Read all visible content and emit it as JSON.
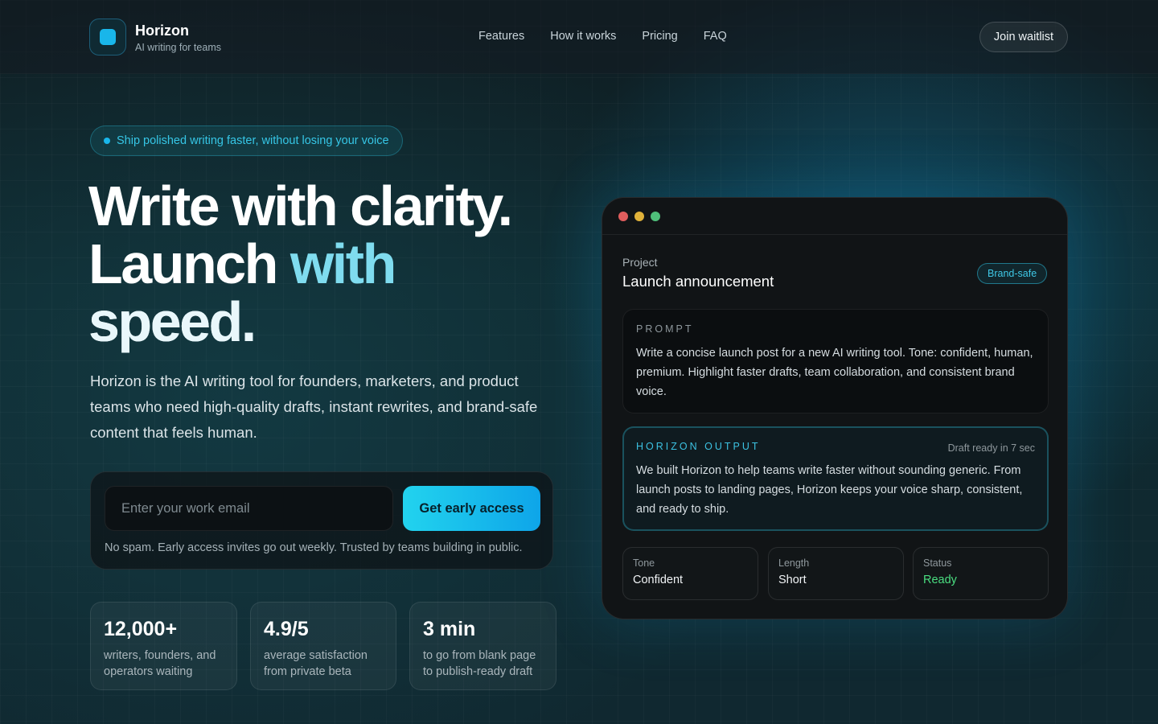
{
  "header": {
    "brand_name": "Horizon",
    "brand_tagline": "AI writing for teams",
    "nav": [
      "Features",
      "How it works",
      "Pricing",
      "FAQ"
    ],
    "cta_label": "Join waitlist"
  },
  "hero": {
    "pill_text": "Ship polished writing faster, without losing your voice",
    "headline_line1": "Write with clarity.",
    "headline_line2a": "Launch",
    "headline_line2b": "with",
    "headline_line3": "speed.",
    "lead": "Horizon is the AI writing tool for founders, marketers, and product teams who need high-quality drafts, instant rewrites, and brand-safe content that feels human."
  },
  "signup": {
    "placeholder": "Enter your work email",
    "button_label": "Get early access",
    "note": "No spam. Early access invites go out weekly. Trusted by teams building in public."
  },
  "stats": [
    {
      "value": "12,000+",
      "label": "writers, founders, and operators waiting"
    },
    {
      "value": "4.9/5",
      "label": "average satisfaction from private beta"
    },
    {
      "value": "3 min",
      "label": "to go from blank page to publish-ready draft"
    }
  ],
  "card": {
    "window_dot_colors": [
      "#e05d5d",
      "#e0b23a",
      "#4fbf7a"
    ],
    "project_label": "Project",
    "project_title": "Launch announcement",
    "badge": "Brand-safe",
    "prompt_label": "PROMPT",
    "prompt_text": "Write a concise launch post for a new AI writing tool. Tone: confident, human, premium. Highlight faster drafts, team collaboration, and consistent brand voice.",
    "output_label": "HORIZON OUTPUT",
    "output_meta": "Draft ready in 7 sec",
    "output_text": "We built Horizon to help teams write faster without sounding generic. From launch posts to landing pages, Horizon keeps your voice sharp, consistent, and ready to ship.",
    "settings": [
      {
        "label": "Tone",
        "value": "Confident"
      },
      {
        "label": "Length",
        "value": "Short"
      },
      {
        "label": "Status",
        "value": "Ready"
      }
    ],
    "status_color": "#4ade80"
  },
  "colors": {
    "accent": "#19b6ea",
    "accent_text": "#7fdcef"
  }
}
